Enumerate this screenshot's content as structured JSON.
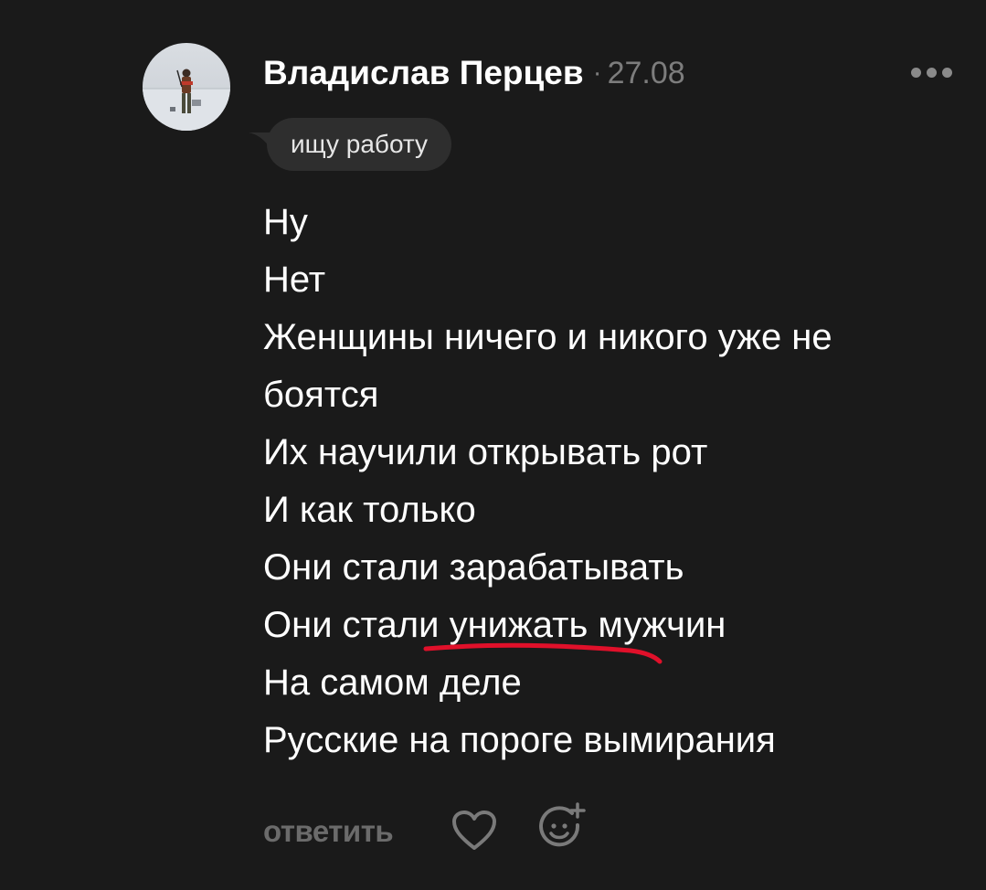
{
  "comment": {
    "author": "Владислав Перцев",
    "separator": "·",
    "date": "27.08",
    "status": "ищу работу",
    "lines": [
      "Ну",
      "Нет",
      "Женщины ничего и никого уже не",
      "боятся",
      "Их научили открывать рот",
      "И как только",
      "Они стали зарабатывать",
      "Они стали унижать мужчин",
      "На самом деле",
      "Русские на пороге вымирания"
    ],
    "reply_label": "ответить"
  },
  "icons": {
    "more": "more-dots-icon",
    "like": "heart-icon",
    "react": "add-reaction-icon"
  },
  "colors": {
    "background": "#1a1a1a",
    "muted": "#7d7d7d",
    "status_bubble": "#2e2e2e",
    "underline": "#e0102a"
  }
}
